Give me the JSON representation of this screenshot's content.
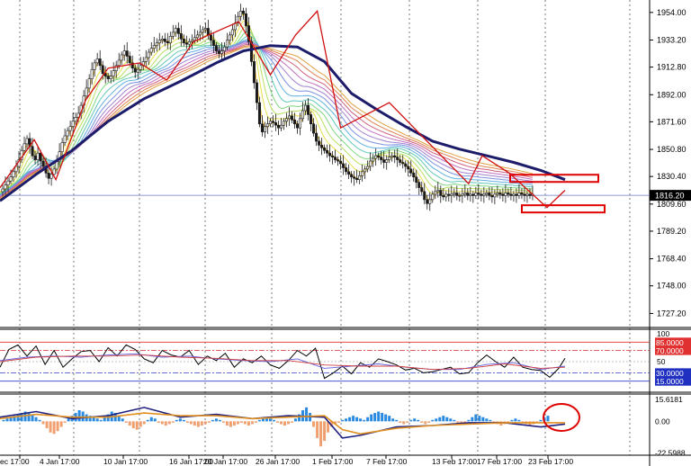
{
  "chart_data": {
    "type": "line",
    "instrument_note": "candlestick price chart with moving-average ribbon, oscillator and histogram panes",
    "time_labels": [
      "ec 17:00",
      "4 Jan 17:00",
      "10 Jan 17:00",
      "16 Jan 17:00",
      "20 Jan 17:00",
      "26 Jan 17:00",
      "1 Feb 17:00",
      "7 Feb 17:00",
      "13 Feb 17:00",
      "17 Feb 17:00",
      "23 Feb 17:00"
    ],
    "price_axis": {
      "ticks": [
        "1954.00",
        "1933.20",
        "1912.80",
        "1892.00",
        "1871.60",
        "1850.80",
        "1830.40",
        "1809.60",
        "1789.20",
        "1768.40",
        "1748.00",
        "1727.20"
      ],
      "ylim": [
        1718,
        1962
      ],
      "current_price": "1816.20"
    },
    "price_series": {
      "name": "close",
      "x": [
        0,
        3,
        6,
        9,
        12,
        15,
        18,
        21,
        24,
        27,
        30,
        33,
        36,
        39,
        42,
        45,
        48,
        51,
        54,
        57,
        60,
        63,
        66,
        69,
        72,
        75,
        78,
        81,
        84,
        87,
        90,
        93,
        96,
        99,
        102,
        105,
        108,
        111,
        114,
        117,
        120,
        123,
        126,
        129,
        132,
        135,
        138,
        141,
        144,
        147,
        150,
        153,
        156,
        159,
        162,
        165,
        168,
        171,
        174,
        177,
        180,
        183,
        186,
        189,
        192,
        195,
        198,
        201,
        204,
        207,
        210,
        213,
        216,
        219,
        222,
        225,
        228,
        231,
        234,
        237,
        240,
        243,
        246,
        249,
        252,
        255,
        258,
        261,
        264,
        267,
        270,
        273,
        276,
        279,
        282,
        285,
        288,
        291,
        294,
        297,
        300,
        303,
        306,
        309,
        312,
        315,
        318,
        321,
        324,
        327,
        330,
        333,
        336,
        339,
        342,
        345,
        348,
        351,
        354,
        357,
        360,
        363,
        366,
        369,
        372,
        375,
        378,
        381,
        384,
        387,
        390,
        393,
        396,
        399,
        402,
        405,
        408,
        411,
        414,
        417,
        420,
        423,
        426,
        429,
        432,
        435,
        438,
        441,
        444,
        447,
        450,
        453,
        456,
        459,
        462,
        465,
        468,
        471,
        474,
        477,
        480,
        483,
        486,
        489,
        492,
        495,
        498,
        501,
        504,
        507,
        510,
        513,
        516,
        519,
        522,
        525,
        528,
        531,
        534,
        537,
        540,
        543,
        546,
        549,
        552,
        555,
        558,
        561,
        564,
        567,
        570,
        573,
        576,
        579,
        582,
        585,
        588,
        591,
        594,
        597,
        600,
        603,
        606,
        609,
        612,
        615,
        618,
        621,
        624,
        627
      ],
      "y": [
        1819,
        1821,
        1824,
        1827,
        1830,
        1834,
        1838,
        1843,
        1850,
        1855,
        1859,
        1853,
        1846,
        1843,
        1848,
        1842,
        1838,
        1833,
        1829,
        1832,
        1836,
        1842,
        1849,
        1856,
        1861,
        1865,
        1868,
        1872,
        1875,
        1878,
        1884,
        1891,
        1897,
        1904,
        1911,
        1916,
        1919,
        1914,
        1908,
        1906,
        1904,
        1906,
        1910,
        1914,
        1918,
        1922,
        1925,
        1921,
        1916,
        1912,
        1909,
        1911,
        1914,
        1917,
        1920,
        1924,
        1927,
        1929,
        1931,
        1933,
        1934,
        1932,
        1931,
        1936,
        1939,
        1942,
        1938,
        1934,
        1931,
        1930,
        1932,
        1933,
        1935,
        1937,
        1939,
        1941,
        1942,
        1937,
        1933,
        1929,
        1925,
        1923,
        1925,
        1928,
        1933,
        1937,
        1941,
        1946,
        1951,
        1955,
        1953,
        1944,
        1932,
        1917,
        1901,
        1886,
        1870,
        1864,
        1868,
        1870,
        1872,
        1871,
        1869,
        1867,
        1869,
        1872,
        1874,
        1876,
        1873,
        1870,
        1867,
        1874,
        1880,
        1884,
        1877,
        1870,
        1863,
        1857,
        1854,
        1852,
        1850,
        1848,
        1846,
        1845,
        1843,
        1842,
        1840,
        1837,
        1834,
        1832,
        1830,
        1829,
        1828,
        1831,
        1834,
        1836,
        1838,
        1842,
        1844,
        1846,
        1845,
        1843,
        1841,
        1843,
        1845,
        1846,
        1845,
        1843,
        1841,
        1840,
        1838,
        1836,
        1833,
        1830,
        1826,
        1822,
        1819,
        1813,
        1810,
        1813,
        1817,
        1819,
        1820,
        1816,
        1815,
        1817,
        1816,
        1817,
        1818,
        1816,
        1816,
        1817,
        1818,
        1816,
        1817,
        1816,
        1818,
        1817,
        1816,
        1817,
        1818,
        1816,
        1815,
        1817,
        1818,
        1817,
        1816,
        1818,
        1817,
        1816,
        1817,
        1816,
        1818,
        1817,
        1816,
        1817,
        1816,
        1817
      ]
    },
    "ma_series": {
      "name": "slow MA",
      "x": [
        0,
        40,
        80,
        120,
        160,
        200,
        240,
        270,
        300,
        330,
        360,
        390,
        420,
        450,
        480,
        510,
        540,
        570,
        600,
        627
      ],
      "y": [
        1812,
        1832,
        1850,
        1872,
        1889,
        1902,
        1916,
        1925,
        1929,
        1928,
        1917,
        1893,
        1880,
        1868,
        1857,
        1851,
        1846,
        1841,
        1835,
        1828
      ]
    },
    "zigzag": {
      "x": [
        0,
        38,
        62,
        95,
        120,
        155,
        185,
        215,
        265,
        300,
        328,
        352,
        378,
        432,
        520,
        535,
        565,
        607,
        627
      ],
      "y": [
        1822,
        1858,
        1828,
        1888,
        1912,
        1916,
        1903,
        1932,
        1947,
        1907,
        1937,
        1955,
        1867,
        1886,
        1825,
        1846,
        1833,
        1807,
        1820
      ]
    },
    "price_annotations": [
      {
        "type": "rectangle",
        "color": "#e00000",
        "price": 1829
      },
      {
        "type": "rectangle",
        "color": "#e00000",
        "price": 1806
      }
    ],
    "oscillator": {
      "ticks": [
        "100",
        "85.0000",
        "70.0000",
        "50",
        "30.0000",
        "15.0000"
      ],
      "ylim": [
        0,
        100
      ],
      "levels": [
        85,
        70,
        30,
        15
      ],
      "series": [
        {
          "color": "#000000",
          "x": [
            0,
            10,
            20,
            30,
            40,
            50,
            60,
            70,
            80,
            90,
            100,
            110,
            120,
            130,
            140,
            150,
            160,
            170,
            180,
            190,
            200,
            210,
            220,
            230,
            240,
            250,
            260,
            270,
            280,
            290,
            300,
            310,
            320,
            330,
            340,
            350,
            360,
            370,
            380,
            390,
            400,
            410,
            420,
            430,
            440,
            450,
            460,
            470,
            480,
            490,
            500,
            510,
            520,
            530,
            540,
            550,
            560,
            570,
            580,
            590,
            600,
            610,
            620,
            627
          ],
          "y": [
            40,
            72,
            80,
            60,
            78,
            45,
            70,
            40,
            55,
            68,
            70,
            50,
            75,
            60,
            80,
            72,
            55,
            48,
            70,
            62,
            58,
            70,
            45,
            60,
            52,
            65,
            40,
            55,
            48,
            60,
            44,
            38,
            52,
            70,
            60,
            74,
            20,
            30,
            42,
            28,
            48,
            40,
            55,
            50,
            44,
            35,
            38,
            30,
            32,
            36,
            40,
            28,
            30,
            48,
            62,
            50,
            40,
            58,
            40,
            36,
            34,
            22,
            38,
            56
          ]
        },
        {
          "color": "#6060e0",
          "x": [
            0,
            30,
            60,
            90,
            120,
            150,
            180,
            210,
            240,
            270,
            300,
            330,
            360,
            390,
            420,
            450,
            480,
            510,
            540,
            570,
            600,
            627
          ],
          "y": [
            52,
            58,
            60,
            58,
            62,
            64,
            58,
            60,
            55,
            52,
            50,
            55,
            38,
            42,
            46,
            40,
            36,
            36,
            45,
            48,
            36,
            42
          ]
        },
        {
          "color": "#d04040",
          "x": [
            0,
            40,
            80,
            120,
            160,
            200,
            240,
            280,
            320,
            360,
            400,
            440,
            480,
            520,
            560,
            600,
            627
          ],
          "y": [
            50,
            58,
            60,
            60,
            62,
            58,
            56,
            52,
            52,
            44,
            42,
            42,
            36,
            38,
            46,
            38,
            40
          ]
        }
      ]
    },
    "histogram": {
      "ticks": [
        "15.6181",
        "0.00",
        "-22.5988"
      ],
      "ylim": [
        -23,
        17
      ],
      "bars_x": [
        4,
        8,
        12,
        16,
        20,
        24,
        28,
        32,
        36,
        40,
        44,
        48,
        52,
        56,
        60,
        64,
        68,
        72,
        76,
        80,
        84,
        88,
        92,
        96,
        100,
        104,
        108,
        112,
        116,
        120,
        124,
        128,
        132,
        136,
        140,
        144,
        148,
        152,
        156,
        160,
        164,
        168,
        172,
        176,
        180,
        184,
        188,
        192,
        196,
        200,
        204,
        208,
        212,
        216,
        220,
        224,
        228,
        232,
        236,
        240,
        244,
        248,
        252,
        256,
        260,
        264,
        268,
        272,
        276,
        280,
        284,
        288,
        292,
        296,
        300,
        304,
        308,
        312,
        316,
        320,
        324,
        328,
        332,
        336,
        340,
        344,
        348,
        352,
        356,
        360,
        364,
        368,
        372,
        376,
        380,
        384,
        388,
        392,
        396,
        400,
        404,
        408,
        412,
        416,
        420,
        424,
        428,
        432,
        436,
        440,
        444,
        448,
        452,
        456,
        460,
        464,
        468,
        472,
        476,
        480,
        484,
        488,
        492,
        496,
        500,
        504,
        508,
        512,
        516,
        520,
        524,
        528,
        532,
        536,
        540,
        544,
        548,
        552,
        556,
        560,
        564,
        568,
        572,
        576,
        580,
        584,
        588,
        592,
        596,
        600,
        604,
        608,
        612,
        616,
        620,
        624
      ],
      "bars_y": [
        1,
        2,
        3,
        4,
        5,
        6,
        7,
        6,
        5,
        3,
        1,
        -2,
        -5,
        -8,
        -9,
        -7,
        -4,
        -1,
        2,
        4,
        6,
        8,
        7,
        5,
        4,
        3,
        2,
        1,
        3,
        5,
        7,
        6,
        4,
        2,
        -1,
        -3,
        -5,
        -6,
        -4,
        -2,
        1,
        3,
        2,
        -1,
        -2,
        -3,
        -2,
        -1,
        1,
        2,
        1,
        -1,
        -2,
        -3,
        -4,
        -3,
        -2,
        -1,
        1,
        2,
        1,
        -1,
        -3,
        -4,
        -3,
        -2,
        -1,
        -2,
        -3,
        -2,
        -1,
        1,
        2,
        3,
        2,
        1,
        -1,
        -2,
        -3,
        -2,
        -1,
        2,
        5,
        8,
        10,
        6,
        -4,
        -12,
        -18,
        -14,
        -8,
        -4,
        -2,
        -1,
        1,
        2,
        3,
        4,
        3,
        2,
        1,
        3,
        5,
        6,
        7,
        6,
        5,
        4,
        2,
        1,
        -1,
        -2,
        -1,
        1,
        2,
        1,
        -1,
        -2,
        -1,
        1,
        2,
        3,
        4,
        3,
        2,
        1,
        -1,
        -2,
        -1,
        1,
        3,
        5,
        4,
        3,
        2,
        1,
        -1,
        -2,
        -3,
        -2,
        -1,
        1,
        2,
        1,
        -1,
        -2,
        -3,
        -2,
        -1,
        1,
        3,
        4
      ],
      "line_series": [
        {
          "color": "#202080",
          "x": [
            0,
            40,
            80,
            120,
            160,
            200,
            240,
            280,
            320,
            360,
            380,
            400,
            440,
            480,
            520,
            560,
            600,
            627
          ],
          "y": [
            3,
            7,
            2,
            4,
            10,
            3,
            5,
            2,
            4,
            3,
            -12,
            -10,
            -4,
            -3,
            -1,
            -1,
            -4,
            -2
          ]
        },
        {
          "color": "#e09020",
          "x": [
            0,
            40,
            80,
            120,
            160,
            200,
            240,
            280,
            320,
            360,
            380,
            400,
            440,
            480,
            520,
            560,
            600,
            627
          ],
          "y": [
            2,
            5,
            3,
            3,
            6,
            4,
            4,
            2,
            3,
            4,
            -6,
            -9,
            -5,
            -3,
            -2,
            -1,
            -1,
            -1
          ]
        }
      ],
      "annotation": {
        "type": "circle",
        "color": "#e00000"
      }
    }
  }
}
